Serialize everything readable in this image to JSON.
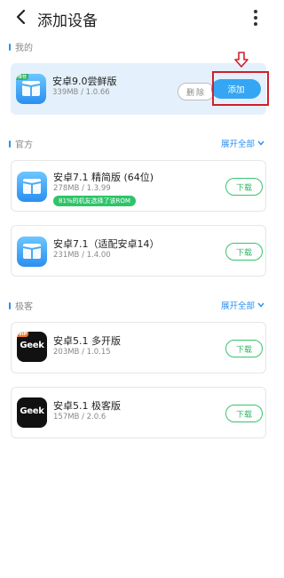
{
  "header": {
    "title": "添加设备",
    "back_icon": "back-chevron-icon",
    "more_icon": "more-vertical-icon"
  },
  "colors": {
    "accent": "#2a8ff0",
    "download_green": "#35c46e",
    "highlight_red": "#d01f2b",
    "mine_bg": "#e4f1fc"
  },
  "mine": {
    "label": "我的",
    "app": {
      "name": "安卓9.0尝鲜版",
      "meta": "339MB / 1.0.66",
      "badge": "推荐",
      "icon": "android-window-icon"
    },
    "delete_label": "删除",
    "add_label": "添加"
  },
  "official": {
    "label": "官方",
    "expand_label": "展开全部",
    "apps": [
      {
        "name": "安卓7.1 精简版 (64位)",
        "meta": "278MB / 1.3.99",
        "tag": "81%的机友选择了该ROM",
        "action": "下载",
        "icon": "android-window-icon"
      },
      {
        "name": "安卓7.1（适配安卓14）",
        "meta": "231MB / 1.4.00",
        "action": "下载",
        "icon": "android-window-icon"
      }
    ]
  },
  "geek": {
    "label": "极客",
    "expand_label": "展开全部",
    "apps": [
      {
        "name": "安卓5.1 多开版",
        "meta": "203MB / 1.0.15",
        "action": "下载",
        "icon": "geek-logo-icon",
        "icon_text": "Geek",
        "vip": "VIP"
      },
      {
        "name": "安卓5.1 极客版",
        "meta": "157MB / 2.0.6",
        "action": "下载",
        "icon": "geek-logo-icon",
        "icon_text": "Geek"
      }
    ]
  }
}
